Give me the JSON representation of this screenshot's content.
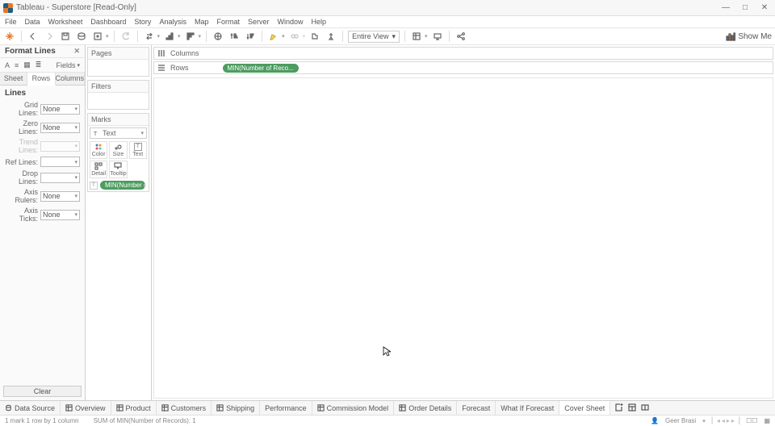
{
  "title": "Tableau - Superstore [Read-Only]",
  "menu": [
    "File",
    "Data",
    "Worksheet",
    "Dashboard",
    "Story",
    "Analysis",
    "Map",
    "Format",
    "Server",
    "Window",
    "Help"
  ],
  "toolbar": {
    "view_mode": "Entire View",
    "show_me": "Show Me"
  },
  "format": {
    "title": "Format Lines",
    "fields_label": "Fields",
    "tabs": [
      "Sheet",
      "Rows",
      "Columns"
    ],
    "active_tab": 1,
    "section": "Lines",
    "rows": [
      {
        "label": "Grid Lines:",
        "value": "None",
        "enabled": true
      },
      {
        "label": "Zero Lines:",
        "value": "None",
        "enabled": true
      },
      {
        "label": "Trend Lines:",
        "value": "",
        "enabled": false
      },
      {
        "label": "Ref Lines:",
        "value": "",
        "enabled": true
      },
      {
        "label": "Drop Lines:",
        "value": "",
        "enabled": true
      },
      {
        "label": "Axis Rulers:",
        "value": "None",
        "enabled": true
      },
      {
        "label": "Axis Ticks:",
        "value": "None",
        "enabled": true
      }
    ],
    "clear": "Clear"
  },
  "side": {
    "pages": "Pages",
    "filters": "Filters",
    "marks": "Marks",
    "mark_type": "Text",
    "mark_cells": [
      "Color",
      "Size",
      "Text",
      "Detail",
      "Tooltip"
    ],
    "marks_pill": "MIN(Number o..."
  },
  "shelves": {
    "columns": "Columns",
    "rows": "Rows",
    "row_pill": "MIN(Number of Reco..."
  },
  "tabs": {
    "data_source": "Data Source",
    "sheets": [
      "Overview",
      "Product",
      "Customers",
      "Shipping",
      "Performance",
      "Commission Model",
      "Order Details",
      "Forecast",
      "What If Forecast",
      "Cover Sheet"
    ],
    "active": 9
  },
  "status": {
    "marks": "1 mark    1 row by 1 column",
    "sum": "SUM of MIN(Number of Records): 1",
    "user": "Geer Brasi"
  }
}
